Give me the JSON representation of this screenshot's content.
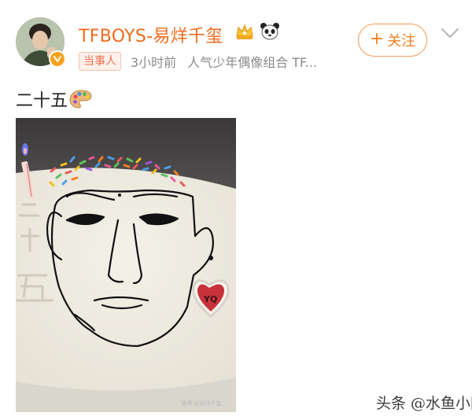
{
  "post": {
    "author": {
      "name": "TFBOYS-易烊千玺",
      "badge_icons": [
        "crown-icon",
        "panda-icon"
      ],
      "verified": true
    },
    "tag": "当事人",
    "time": "3小时前",
    "source": "人气少年偶像组合 TF...",
    "follow_label": "关注",
    "text": "二十五",
    "text_emoji": "palette-emoji",
    "image": {
      "cake_writing": [
        "二",
        "十",
        "五"
      ],
      "heart_text": "YQ",
      "image_watermark": "微博 @易烊千玺"
    }
  },
  "page_watermark": "头条 @水鱼小网",
  "colors": {
    "name": "#f26a1b",
    "accent": "#f3801f",
    "tag_text": "#eb7350",
    "meta": "#8a8a8a",
    "text": "#222222"
  }
}
